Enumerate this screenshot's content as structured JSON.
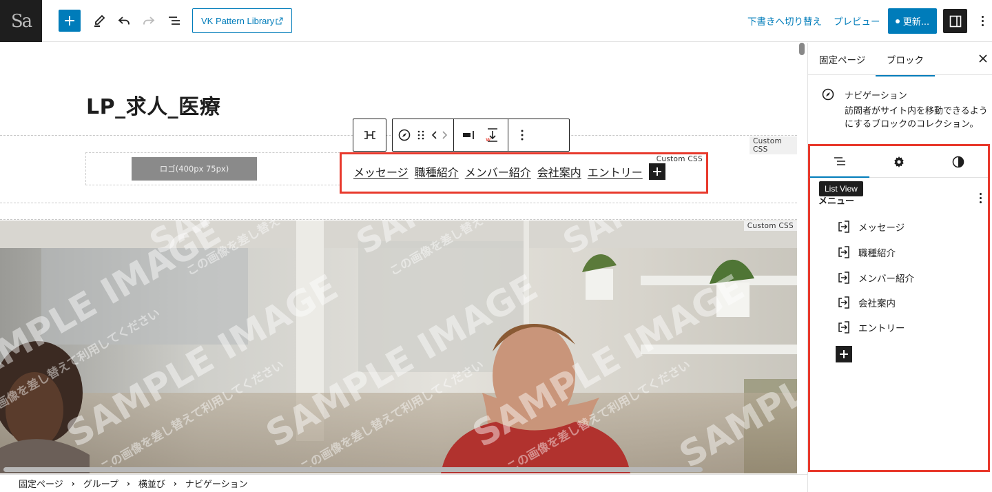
{
  "topbar": {
    "site_logo": "Sa",
    "pattern_library": "VK Pattern Library",
    "switch_to_draft": "下書きへ切り替え",
    "preview": "プレビュー",
    "update": "更新..."
  },
  "canvas": {
    "title": "LP_求人_医療",
    "logo_placeholder": "ロゴ(400px 75px)",
    "custom_css_label": "Custom CSS",
    "nav_items": [
      "メッセージ",
      "職種紹介",
      "メンバー紹介",
      "会社案内",
      "エントリー"
    ],
    "hero_watermark_main": "SAMPLE IMAGE",
    "hero_watermark_sub": "この画像を差し替えて利用してください"
  },
  "sidebar": {
    "tabs": [
      "固定ページ",
      "ブロック"
    ],
    "active_tab": "ブロック",
    "block_name": "ナビゲーション",
    "block_description": "訪問者がサイト内を移動できるようにするブロックのコレクション。",
    "tooltip": "List View",
    "menu_label": "メニュー",
    "links": [
      "メッセージ",
      "職種紹介",
      "メンバー紹介",
      "会社案内",
      "エントリー"
    ]
  },
  "breadcrumb": [
    "固定ページ",
    "グループ",
    "横並び",
    "ナビゲーション"
  ],
  "colors": {
    "accent": "#007cba",
    "highlight": "#e8392c",
    "dark": "#1e1e1e"
  }
}
